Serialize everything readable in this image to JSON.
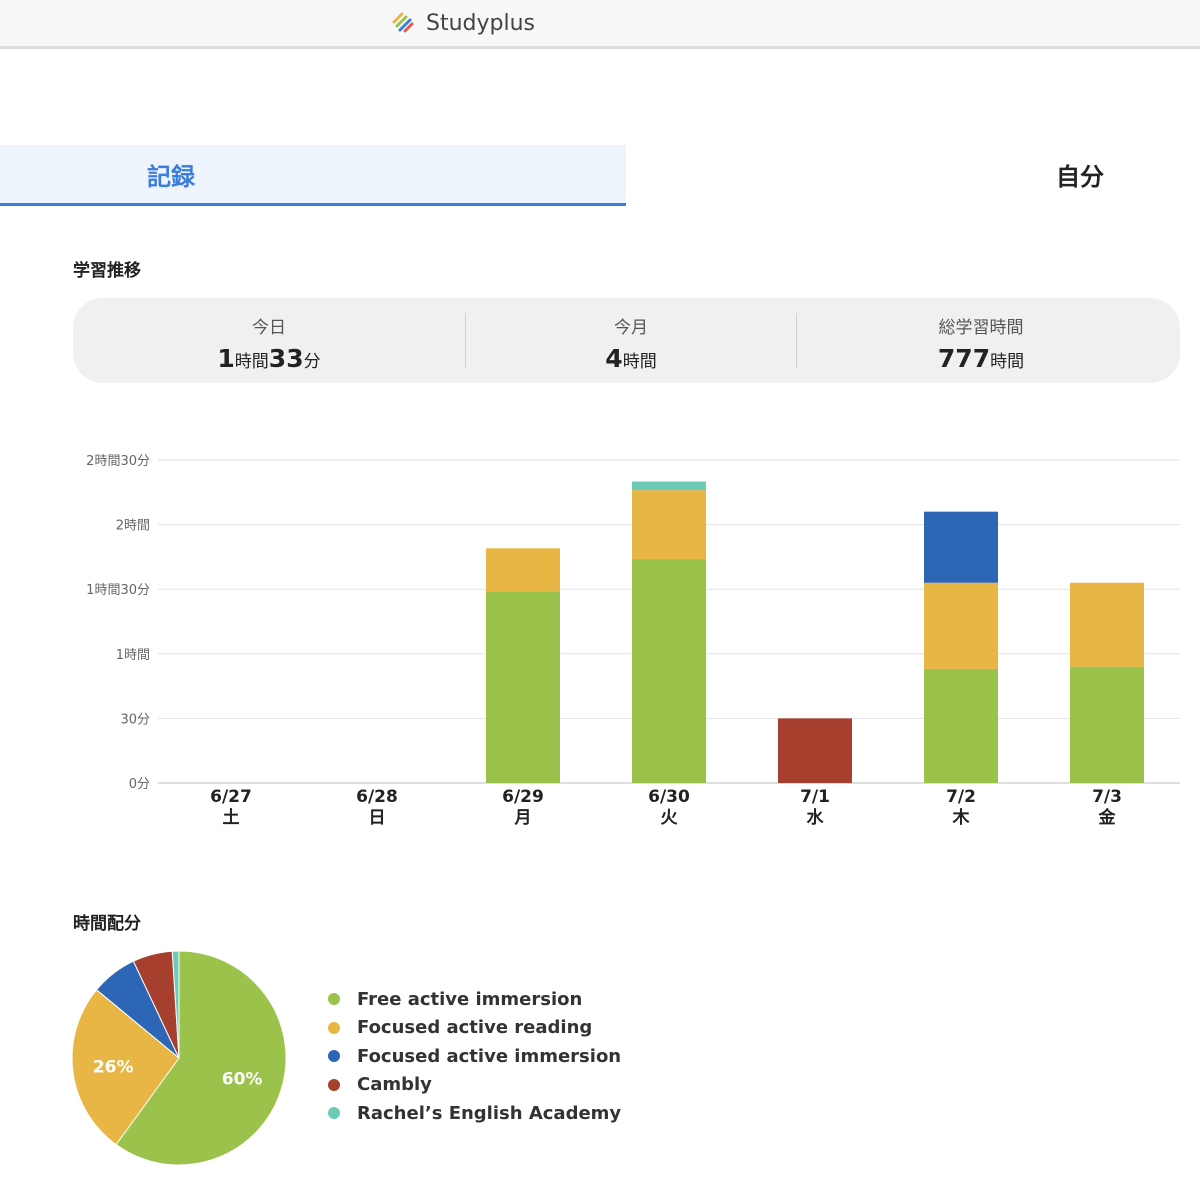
{
  "header": {
    "brand": "Studyplus"
  },
  "tabs": [
    {
      "label": "記録",
      "active": true
    },
    {
      "label": "自分",
      "active": false
    }
  ],
  "trend_title": "学習推移",
  "summary": [
    {
      "label": "今日",
      "parts": [
        {
          "n": "1",
          "u": "時間"
        },
        {
          "n": "33",
          "u": "分"
        }
      ]
    },
    {
      "label": "今月",
      "parts": [
        {
          "n": "4",
          "u": "時間"
        }
      ]
    },
    {
      "label": "総学習時間",
      "parts": [
        {
          "n": "777",
          "u": "時間"
        }
      ]
    }
  ],
  "allocation_title": "時間配分",
  "colors": {
    "Free active immersion": "#9bc24a",
    "Focused active reading": "#e8b645",
    "Focused active immersion": "#2c66b4",
    "Cambly": "#a63f2e",
    "Rachel’s English Academy": "#6ccbb4"
  },
  "chart_data": [
    {
      "type": "bar",
      "stacked": true,
      "unit": "minutes",
      "categories": [
        "6/27",
        "6/28",
        "6/29",
        "6/30",
        "7/1",
        "7/2",
        "7/3"
      ],
      "weekdays": [
        "土",
        "日",
        "月",
        "火",
        "水",
        "木",
        "金"
      ],
      "yticks": [
        {
          "value": 0,
          "label": "0分"
        },
        {
          "value": 30,
          "label": "30分"
        },
        {
          "value": 60,
          "label": "1時間"
        },
        {
          "value": 90,
          "label": "1時間30分"
        },
        {
          "value": 120,
          "label": "2時間"
        },
        {
          "value": 150,
          "label": "2時間30分"
        }
      ],
      "ylim": [
        0,
        150
      ],
      "grid": true,
      "series": [
        {
          "name": "Free active immersion",
          "values": [
            0,
            0,
            89,
            104,
            0,
            53,
            54
          ]
        },
        {
          "name": "Focused active reading",
          "values": [
            0,
            0,
            20,
            32,
            0,
            40,
            39
          ]
        },
        {
          "name": "Focused active immersion",
          "values": [
            0,
            0,
            0,
            0,
            0,
            33,
            0
          ]
        },
        {
          "name": "Cambly",
          "values": [
            0,
            0,
            0,
            0,
            30,
            0,
            0
          ]
        },
        {
          "name": "Rachel’s English Academy",
          "values": [
            0,
            0,
            0,
            4,
            0,
            0,
            0
          ]
        }
      ]
    },
    {
      "type": "pie",
      "labels": [
        "Free active immersion",
        "Focused active reading",
        "Focused active immersion",
        "Cambly",
        "Rachel’s English Academy"
      ],
      "values": [
        60,
        26,
        7,
        6,
        1
      ],
      "data_labels": [
        "60%",
        "26%",
        "",
        "",
        ""
      ],
      "legend": "right"
    }
  ]
}
